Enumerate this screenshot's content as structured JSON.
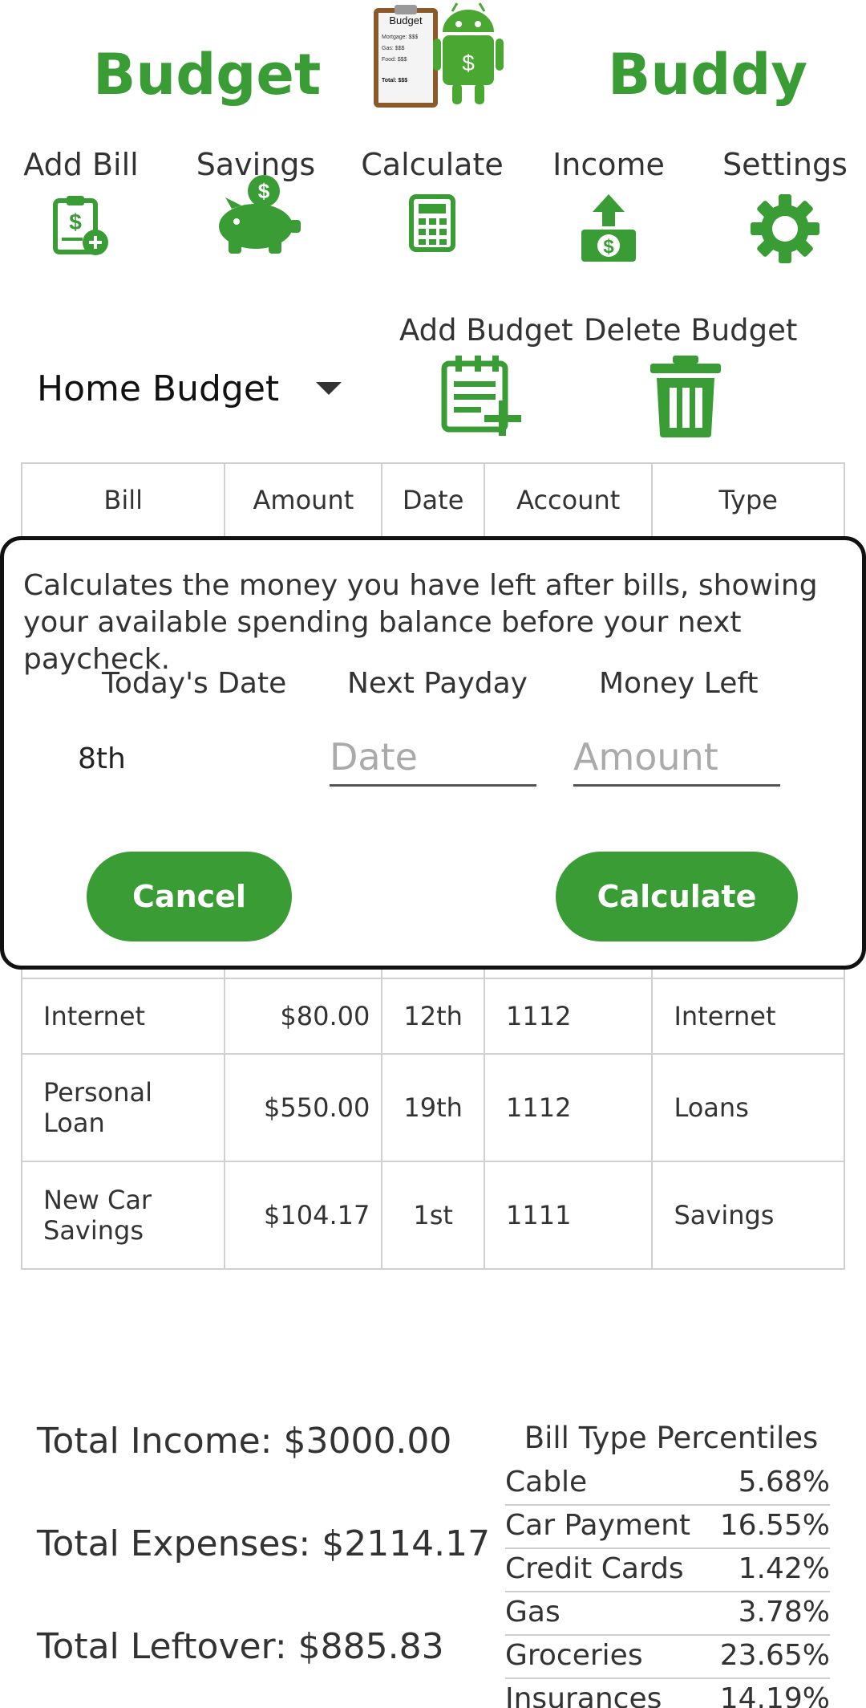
{
  "header": {
    "brand_left": "Budget",
    "brand_right": "Buddy",
    "logo": {
      "clipboard_title": "Budget",
      "clipboard_lines": [
        "Mortgage: $$$",
        "Gas:     $$$",
        "Food:    $$$"
      ],
      "clipboard_total": "Total: $$$",
      "robot_symbol": "$"
    }
  },
  "toolbar": [
    {
      "label": "Add Bill",
      "icon": "add-bill-icon"
    },
    {
      "label": "Savings",
      "icon": "piggy-bank-icon"
    },
    {
      "label": "Calculate",
      "icon": "calculator-icon"
    },
    {
      "label": "Income",
      "icon": "income-icon"
    },
    {
      "label": "Settings",
      "icon": "gear-icon"
    }
  ],
  "budget": {
    "selected": "Home Budget",
    "add_label": "Add Budget",
    "delete_label": "Delete Budget"
  },
  "table": {
    "headers": [
      "Bill",
      "Amount",
      "Date",
      "Account",
      "Type"
    ],
    "rows": [
      {
        "bill": "Internet",
        "amount": "$80.00",
        "date": "12th",
        "account": "1112",
        "type": "Internet"
      },
      {
        "bill": "Personal Loan",
        "amount": "$550.00",
        "date": "19th",
        "account": "1112",
        "type": "Loans"
      },
      {
        "bill": "New Car Savings",
        "amount": "$104.17",
        "date": "1st",
        "account": "1111",
        "type": "Savings"
      }
    ]
  },
  "dialog": {
    "description": "Calculates the money you have left after bills, showing your available spending balance before your next paycheck.",
    "col_today": "Today's Date",
    "col_payday": "Next Payday",
    "col_money": "Money Left",
    "today_value": "8th",
    "date_placeholder": "Date",
    "amount_placeholder": "Amount",
    "cancel_label": "Cancel",
    "calculate_label": "Calculate"
  },
  "totals": {
    "income": "Total Income: $3000.00",
    "expenses": "Total Expenses: $2114.17",
    "leftover": "Total Leftover: $885.83"
  },
  "percentiles": {
    "title": "Bill Type Percentiles",
    "items": [
      {
        "name": "Cable",
        "value": "5.68%"
      },
      {
        "name": "Car Payment",
        "value": "16.55%"
      },
      {
        "name": "Credit Cards",
        "value": "1.42%"
      },
      {
        "name": "Gas",
        "value": "3.78%"
      },
      {
        "name": "Groceries",
        "value": "23.65%"
      },
      {
        "name": "Insurances",
        "value": "14.19%"
      }
    ]
  },
  "colors": {
    "brand_green": "#3a9c34",
    "dialog_border": "#111111"
  }
}
